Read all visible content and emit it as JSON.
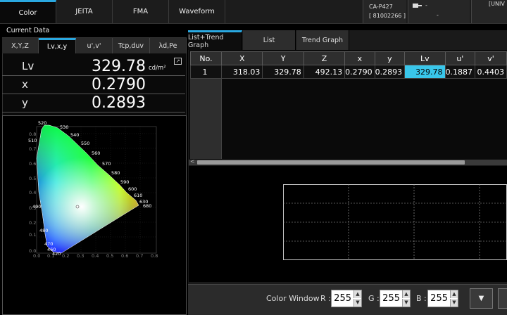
{
  "top_tabs": [
    "Color",
    "JEITA",
    "FMA",
    "Waveform"
  ],
  "device": {
    "model": "CA-P427",
    "serial": "[ 81002266 ]"
  },
  "status": {
    "line1": "-",
    "line2": "-",
    "corner": "[UNIV"
  },
  "current_data_label": "Current Data",
  "mode_tabs": [
    "X,Y,Z",
    "Lv,x,y",
    "u',v'",
    "Tcp,duv",
    "λd,Pe"
  ],
  "values": [
    {
      "label": "Lv",
      "value": "329.78",
      "unit": "cd/m²"
    },
    {
      "label": "x",
      "value": "0.2790",
      "unit": ""
    },
    {
      "label": "y",
      "value": "0.2893",
      "unit": ""
    }
  ],
  "cie": {
    "wavelengths": [
      "520",
      "530",
      "540",
      "550",
      "560",
      "570",
      "580",
      "590",
      "600",
      "610",
      "630",
      "680",
      "510",
      "490",
      "480",
      "470",
      "460",
      "420"
    ],
    "yticks": [
      "0.8",
      "0.7",
      "0.6",
      "0.5",
      "0.4",
      "0.3",
      "0.2",
      "0.1",
      "0.0"
    ],
    "xticks": [
      "0.0",
      "0.1",
      "0.2",
      "0.3",
      "0.4",
      "0.5",
      "0.6",
      "0.7",
      "0.8"
    ],
    "point": {
      "x": 0.279,
      "y": 0.2893
    }
  },
  "view_tabs": [
    "List+Trend Graph",
    "List",
    "Trend Graph"
  ],
  "table": {
    "headers": [
      "No.",
      "X",
      "Y",
      "Z",
      "x",
      "y",
      "Lv",
      "u'",
      "v'"
    ],
    "row": [
      "1",
      "318.03",
      "329.78",
      "492.13",
      "0.2790",
      "0.2893",
      "329.78",
      "0.1887",
      "0.4403"
    ]
  },
  "scroll_left_glyph": "<",
  "bottom": {
    "label": "Color Window",
    "r_label": "R :",
    "g_label": "G :",
    "b_label": "B :",
    "r": "255",
    "g": "255",
    "b": "255",
    "dropdown_glyph": "▼"
  }
}
